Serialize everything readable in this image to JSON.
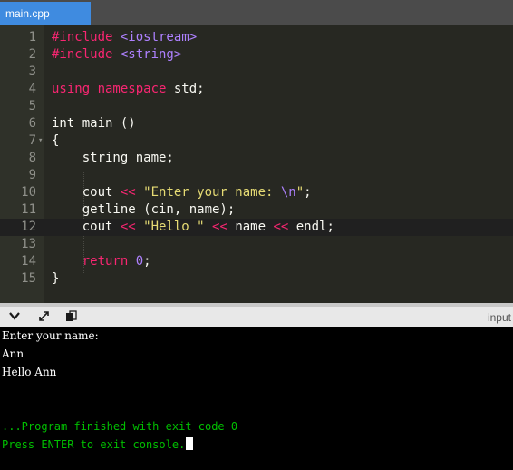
{
  "tab": {
    "label": "main.cpp"
  },
  "editor": {
    "lines": [
      {
        "n": "1",
        "parts": [
          {
            "t": "#include ",
            "c": "kw"
          },
          {
            "t": "<iostream>",
            "c": "hdr"
          }
        ]
      },
      {
        "n": "2",
        "parts": [
          {
            "t": "#include ",
            "c": "kw"
          },
          {
            "t": "<string>",
            "c": "hdr"
          }
        ]
      },
      {
        "n": "3",
        "parts": []
      },
      {
        "n": "4",
        "parts": [
          {
            "t": "using namespace ",
            "c": "kw"
          },
          {
            "t": "std;",
            "c": ""
          }
        ]
      },
      {
        "n": "5",
        "parts": []
      },
      {
        "n": "6",
        "parts": [
          {
            "t": "int main ()",
            "c": ""
          }
        ]
      },
      {
        "n": "7",
        "fold": true,
        "parts": [
          {
            "t": "{",
            "c": ""
          }
        ]
      },
      {
        "n": "8",
        "parts": [
          {
            "t": "    string name;",
            "c": ""
          }
        ]
      },
      {
        "n": "9",
        "parts": []
      },
      {
        "n": "10",
        "parts": [
          {
            "t": "    cout ",
            "c": ""
          },
          {
            "t": "<<",
            "c": "op"
          },
          {
            "t": " ",
            "c": ""
          },
          {
            "t": "\"Enter your name: ",
            "c": "str"
          },
          {
            "t": "\\n",
            "c": "esc"
          },
          {
            "t": "\"",
            "c": "str"
          },
          {
            "t": ";",
            "c": ""
          }
        ]
      },
      {
        "n": "11",
        "parts": [
          {
            "t": "    getline (cin, name);",
            "c": ""
          }
        ]
      },
      {
        "n": "12",
        "active": true,
        "parts": [
          {
            "t": "    cout ",
            "c": ""
          },
          {
            "t": "<<",
            "c": "op"
          },
          {
            "t": " ",
            "c": ""
          },
          {
            "t": "\"Hello \"",
            "c": "str"
          },
          {
            "t": " ",
            "c": ""
          },
          {
            "t": "<<",
            "c": "op"
          },
          {
            "t": " name ",
            "c": ""
          },
          {
            "t": "<<",
            "c": "op"
          },
          {
            "t": " endl;",
            "c": ""
          }
        ]
      },
      {
        "n": "13",
        "parts": []
      },
      {
        "n": "14",
        "parts": [
          {
            "t": "    ",
            "c": ""
          },
          {
            "t": "return ",
            "c": "kw"
          },
          {
            "t": "0",
            "c": "num"
          },
          {
            "t": ";",
            "c": ""
          }
        ]
      },
      {
        "n": "15",
        "parts": [
          {
            "t": "}",
            "c": ""
          }
        ]
      }
    ]
  },
  "toolbar": {
    "icons": [
      "chevron-down-icon",
      "expand-icon",
      "copy-icon"
    ],
    "input_label": "input"
  },
  "console": {
    "lines": [
      {
        "text": "Enter your name:",
        "color": "white"
      },
      {
        "text": "Ann",
        "color": "white"
      },
      {
        "text": "Hello Ann",
        "color": "white"
      },
      {
        "text": "",
        "color": "white"
      },
      {
        "text": "",
        "color": "white"
      },
      {
        "text": "...Program finished with exit code 0",
        "color": "green"
      },
      {
        "text": "Press ENTER to exit console.",
        "color": "green",
        "cursor": true
      }
    ]
  },
  "colors": {
    "tab_accent": "#3f8be0",
    "editor_bg": "#272822",
    "console_green": "#00c000"
  }
}
